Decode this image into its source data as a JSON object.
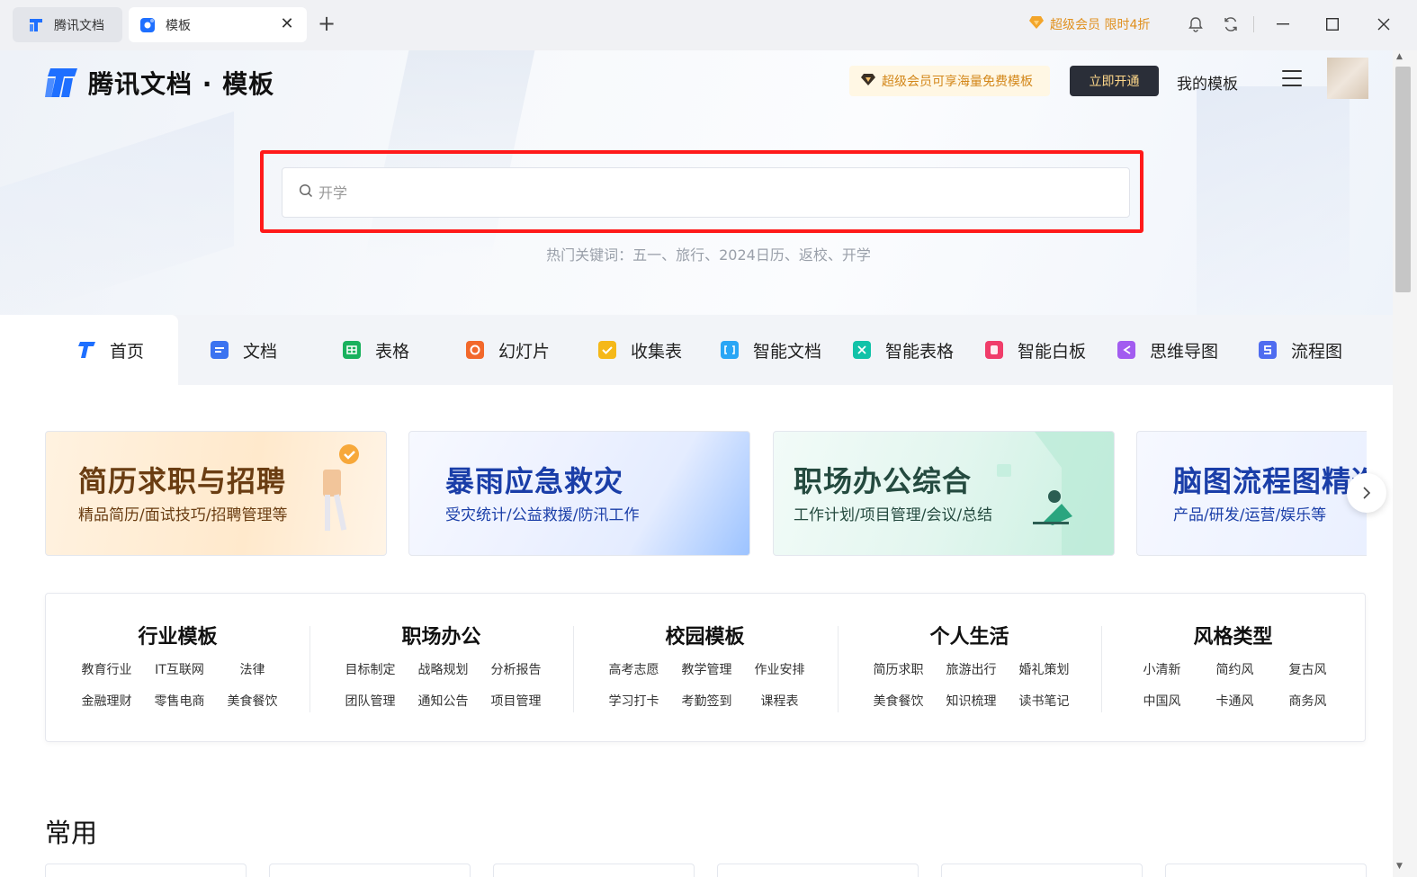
{
  "window": {
    "tabs": [
      {
        "label": "腾讯文档",
        "icon": "tencent-docs-icon"
      },
      {
        "label": "模板",
        "icon": "template-icon",
        "active": true
      }
    ],
    "new_tab_icon": "+",
    "close_icon": "✕",
    "vip_promo": "超级会员 限时4折"
  },
  "header": {
    "logo_text": "腾讯文档 · 模板",
    "vip_banner": "超级会员可享海量免费模板",
    "open_button": "立即开通",
    "my_templates": "我的模板"
  },
  "search": {
    "placeholder": "开学",
    "hot_keywords": "热门关键词：五一、旅行、2024日历、返校、开学"
  },
  "categories": [
    {
      "label": "首页",
      "color": "#2563eb",
      "active": true
    },
    {
      "label": "文档",
      "color": "#3b73f0"
    },
    {
      "label": "表格",
      "color": "#19b15d"
    },
    {
      "label": "幻灯片",
      "color": "#f2682b"
    },
    {
      "label": "收集表",
      "color": "#f5b819"
    },
    {
      "label": "智能文档",
      "color": "#2aa6f5"
    },
    {
      "label": "智能表格",
      "color": "#12c2a8"
    },
    {
      "label": "智能白板",
      "color": "#f03d6a"
    },
    {
      "label": "思维导图",
      "color": "#a25cf0"
    },
    {
      "label": "流程图",
      "color": "#4f6cf0"
    }
  ],
  "banners": [
    {
      "title": "简历求职与招聘",
      "subtitle": "精品简历/面试技巧/招聘管理等"
    },
    {
      "title": "暴雨应急救灾",
      "subtitle": "受灾统计/公益救援/防汛工作"
    },
    {
      "title": "职场办公综合",
      "subtitle": "工作计划/项目管理/会议/总结"
    },
    {
      "title": "脑图流程图精选",
      "subtitle": "产品/研发/运营/娱乐等"
    }
  ],
  "groups": [
    {
      "title": "行业模板",
      "items": [
        "教育行业",
        "IT互联网",
        "法律",
        "金融理财",
        "零售电商",
        "美食餐饮"
      ]
    },
    {
      "title": "职场办公",
      "items": [
        "目标制定",
        "战略规划",
        "分析报告",
        "团队管理",
        "通知公告",
        "项目管理"
      ]
    },
    {
      "title": "校园模板",
      "items": [
        "高考志愿",
        "教学管理",
        "作业安排",
        "学习打卡",
        "考勤签到",
        "课程表"
      ]
    },
    {
      "title": "个人生活",
      "items": [
        "简历求职",
        "旅游出行",
        "婚礼策划",
        "美食餐饮",
        "知识梳理",
        "读书笔记"
      ]
    },
    {
      "title": "风格类型",
      "items": [
        "小清新",
        "简约风",
        "复古风",
        "中国风",
        "卡通风",
        "商务风"
      ]
    }
  ],
  "section": {
    "common_title": "常用"
  },
  "colors": {
    "accent": "#2563eb",
    "vip": "#e0901e",
    "highlight_border": "#ff1a1a"
  }
}
